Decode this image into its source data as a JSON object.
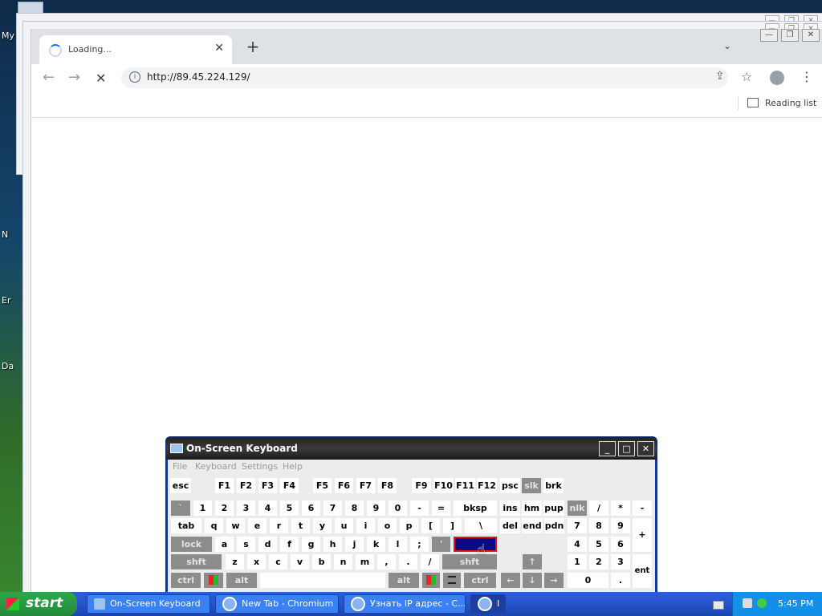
{
  "desktop": {
    "labels": [
      "My",
      "N",
      "Er",
      "Da"
    ]
  },
  "browser": {
    "tab": {
      "title": "Loading...",
      "close": "✕"
    },
    "new_tab": "+",
    "tab_search": "⌄",
    "window_controls": [
      "—",
      "❐",
      "✕"
    ],
    "url": "http://89.45.224.129/",
    "reading_list": "Reading list",
    "nav": {
      "back": "←",
      "forward": "→",
      "stop": "✕"
    },
    "icons": [
      "info-icon",
      "share-icon",
      "star-icon",
      "profile-icon",
      "kebab-menu-icon"
    ]
  },
  "osk": {
    "title": "On-Screen Keyboard",
    "window_controls": [
      "_",
      "□",
      "✕"
    ],
    "menu": [
      "File",
      "Keyboard",
      "Settings",
      "Help"
    ],
    "rows": {
      "function": [
        "esc",
        "F1",
        "F2",
        "F3",
        "F4",
        "F5",
        "F6",
        "F7",
        "F8",
        "F9",
        "F10",
        "F11",
        "F12",
        "psc",
        "slk",
        "brk"
      ],
      "number": [
        "`",
        "1",
        "2",
        "3",
        "4",
        "5",
        "6",
        "7",
        "8",
        "9",
        "0",
        "-",
        "=",
        "bksp",
        "ins",
        "hm",
        "pup",
        "nlk",
        "/",
        "*",
        "-"
      ],
      "top": [
        "tab",
        "q",
        "w",
        "e",
        "r",
        "t",
        "y",
        "u",
        "i",
        "o",
        "p",
        "[",
        "]",
        "\\",
        "del",
        "end",
        "pdn",
        "7",
        "8",
        "9",
        "+"
      ],
      "home": [
        "lock",
        "a",
        "s",
        "d",
        "f",
        "g",
        "h",
        "j",
        "k",
        "l",
        ";",
        "'",
        "",
        "4",
        "5",
        "6"
      ],
      "shift": [
        "shft",
        "z",
        "x",
        "c",
        "v",
        "b",
        "n",
        "m",
        ",",
        ".",
        "/",
        "shft",
        "↑",
        "1",
        "2",
        "3",
        "ent"
      ],
      "bottom": [
        "ctrl",
        "",
        "alt",
        "",
        "alt",
        "",
        "",
        "ctrl",
        "←",
        "↓",
        "→",
        "0",
        "."
      ]
    }
  },
  "taskbar": {
    "start": "start",
    "tasks": [
      "On-Screen Keyboard",
      "New Tab - Chromium",
      "Узнать IP адрес - C...",
      "I"
    ],
    "clock": "5:45 PM"
  },
  "colors": {
    "osk_frame": "#0c3aa0",
    "osk_key_dark": "#8c8c8c",
    "osk_key_selected": "#0b0a86",
    "osk_key_selected_border": "#e01414",
    "taskbar": "#2454c8",
    "start_button": "#238a3a"
  }
}
